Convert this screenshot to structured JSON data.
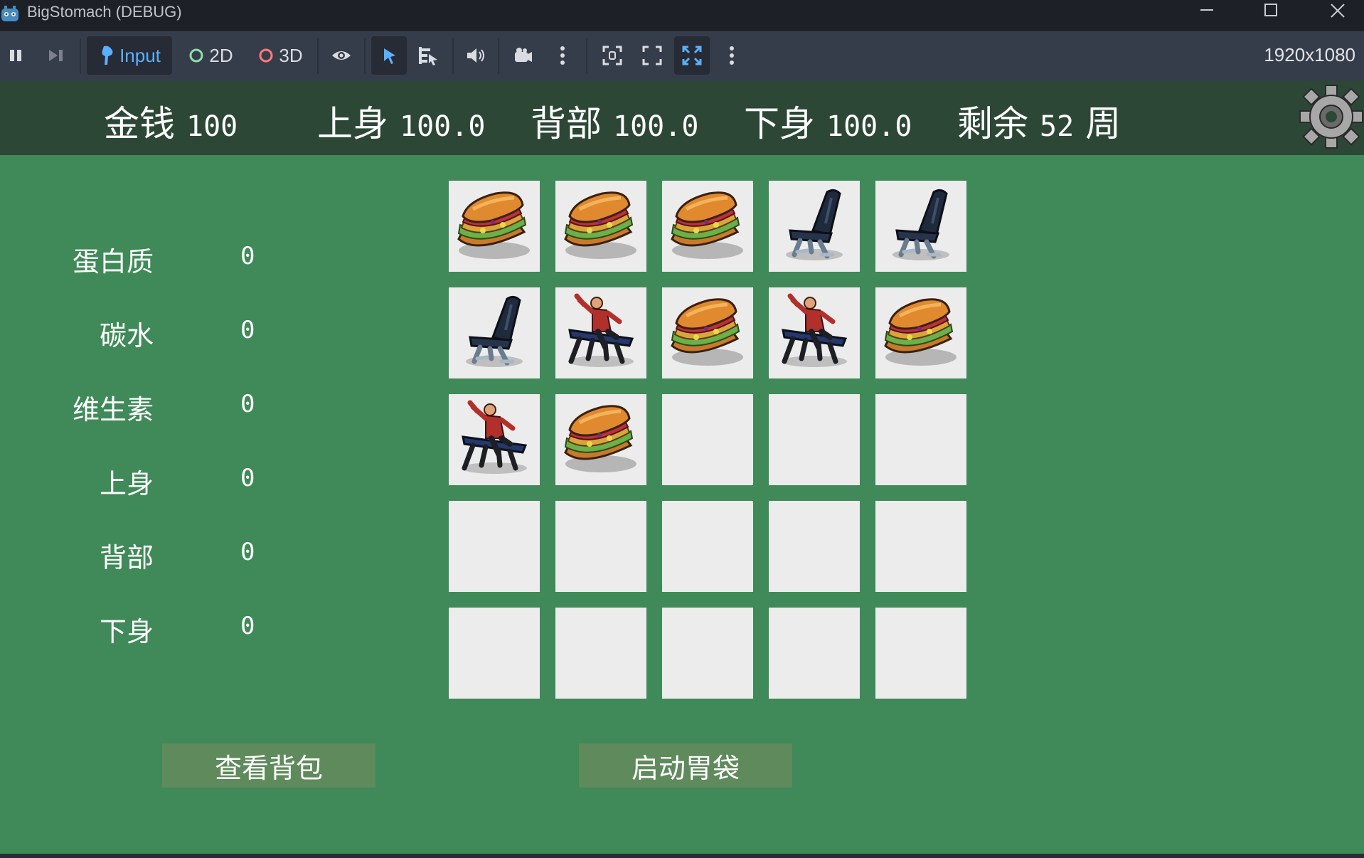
{
  "window": {
    "title": "BigStomach (DEBUG)",
    "resolution": "1920x1080"
  },
  "toolbar": {
    "input_label": "Input",
    "mode_2d_label": "2D",
    "mode_3d_label": "3D",
    "icons": [
      "pause-icon",
      "step-icon",
      "input-icon",
      "eye-icon",
      "select-icon",
      "list-select-icon",
      "speaker-icon",
      "camera-icon",
      "more-icon",
      "focus-icon",
      "fullscreen-icon",
      "expand-icon",
      "more-icon"
    ]
  },
  "hud": {
    "money_label": "金钱",
    "money_value": "100",
    "upper_label": "上身",
    "upper_value": "100.0",
    "back_label": "背部",
    "back_value": "100.0",
    "lower_label": "下身",
    "lower_value": "100.0",
    "remaining_label": "剩余",
    "remaining_value": "52",
    "remaining_unit": "周"
  },
  "stats": [
    {
      "label": "蛋白质",
      "value": "0"
    },
    {
      "label": "碳水",
      "value": "0"
    },
    {
      "label": "维生素",
      "value": "0"
    },
    {
      "label": "上身",
      "value": "0"
    },
    {
      "label": "背部",
      "value": "0"
    },
    {
      "label": "下身",
      "value": "0"
    }
  ],
  "grid": [
    [
      "sandwich",
      "sandwich",
      "sandwich",
      "chair",
      "chair"
    ],
    [
      "chair",
      "bench-press",
      "sandwich",
      "bench-press",
      "sandwich"
    ],
    [
      "bench-press",
      "sandwich",
      "empty",
      "empty",
      "empty"
    ],
    [
      "empty",
      "empty",
      "empty",
      "empty",
      "empty"
    ],
    [
      "empty",
      "empty",
      "empty",
      "empty",
      "empty"
    ]
  ],
  "buttons": {
    "backpack_label": "查看背包",
    "start_label": "启动胃袋"
  },
  "colors": {
    "game_bg": "#3f8a58",
    "hud_bg": "#2d4737",
    "slot_bg": "#ececec",
    "button_bg": "#5f8a5c",
    "toolbar_bg": "#363d4a",
    "accent": "#4aa3ff"
  }
}
